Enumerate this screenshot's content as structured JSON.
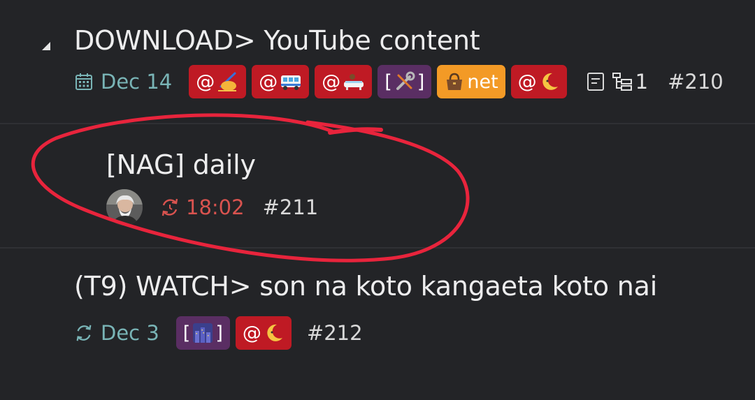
{
  "tasks": [
    {
      "title": "DOWNLOAD> YouTube content",
      "date": "Dec 14",
      "tags": [
        {
          "text": "@",
          "icon": "writing-hand-emoji",
          "color": "#bf1a24"
        },
        {
          "text": "@",
          "icon": "bus-emoji",
          "color": "#bf1a24"
        },
        {
          "text": "@",
          "icon": "bathtub-emoji",
          "color": "#bf1a24"
        },
        {
          "prefix": "[",
          "suffix": "]",
          "icon": "tools-emoji",
          "color": "#5a2e63"
        },
        {
          "text": "net",
          "icon": "handbag-emoji",
          "color": "#f39a26"
        },
        {
          "text": "@",
          "icon": "crescent-moon-emoji",
          "color": "#bf1a24"
        }
      ],
      "subtask_count": "1",
      "id": "#210"
    },
    {
      "title": "[NAG] daily",
      "time": "18:02",
      "id": "#211"
    },
    {
      "title": "(T9) WATCH> son na koto kangaeta koto nai",
      "date": "Dec 3",
      "tags": [
        {
          "prefix": "[",
          "suffix": "]",
          "icon": "night-city-emoji",
          "color": "#5a2e63"
        },
        {
          "text": "@",
          "icon": "crescent-moon-emoji",
          "color": "#bf1a24"
        }
      ],
      "id": "#212"
    }
  ],
  "colors": {
    "background": "#232427",
    "date": "#79b4b6",
    "overdue_time": "#d9534f",
    "annotation": "#e8243c"
  }
}
